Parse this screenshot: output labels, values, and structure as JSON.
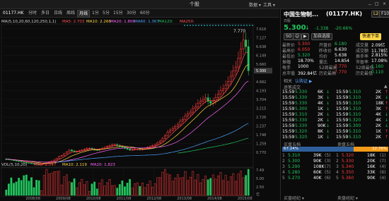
{
  "window": {
    "title": "个股",
    "menu": [
      "数据 ▾",
      "工具 ▾"
    ],
    "controls": [
      "－",
      "□",
      "×"
    ]
  },
  "tabs": {
    "items": [
      "01177.HK",
      "分时",
      "多日",
      "日线",
      "周线",
      "月线",
      "1分",
      "5分",
      "15分",
      "30分",
      "60分"
    ],
    "active": "月线"
  },
  "ma": {
    "label": "MA(5,10,20,60,120,250,1,1)",
    "items": [
      {
        "name": "MA5",
        "value": "2.703",
        "color": "#ff4d4d"
      },
      {
        "name": "MA10",
        "value": "2.266",
        "color": "#ffd84a"
      },
      {
        "name": "MA20",
        "value": "1.806",
        "color": "#ff66ff"
      },
      {
        "name": "MA60",
        "value": "1.367",
        "color": "#4aa3ff"
      },
      {
        "name": "MA120",
        "value": "",
        "color": "#22c55e"
      },
      {
        "name": "MA250",
        "value": "",
        "color": "#ff5555"
      }
    ],
    "gear_icon": "gear-icon"
  },
  "price_axis": [
    "7.616",
    "7.127",
    "6.638",
    "6.149",
    "5.660",
    "5.300",
    "4.682",
    "4.193",
    "3.704",
    "3.215",
    "2.726",
    "2.237",
    "1.748",
    "1.259",
    "0.770"
  ],
  "price_axis_highlight": "5.300",
  "peak_label": "7.770",
  "low_label": "0.110",
  "date_axis": [
    "2008/08",
    "2009/08",
    "2010/08",
    "2011/08",
    "2012/08",
    "2013/08",
    "2014/08",
    "2015/08"
  ],
  "vol": {
    "label": "VOL(5,10,20)",
    "items": [
      {
        "name": "MA5",
        "value": "2.047",
        "color": "#ff4d4d"
      },
      {
        "name": "MA10",
        "value": "2.119",
        "color": "#ffd84a"
      },
      {
        "name": "MA20",
        "value": "1.823",
        "color": "#ff66ff"
      }
    ],
    "axis": [
      "7.49",
      "5.00",
      "2.50",
      "亿"
    ],
    "unit": "亿"
  },
  "stock": {
    "name": "中国生物制...",
    "code": "(01177.HK)",
    "tag": "日股",
    "price": "5.300",
    "arrow": "↓",
    "change": "-1.338",
    "change_pct": "-20.66%",
    "buttons": [
      "SO",
      "☺",
      "▶",
      "加自选股"
    ],
    "badges": [
      "L2",
      "F10"
    ],
    "trade_button": "快速下单",
    "scroll_up": "▲"
  },
  "quote": [
    {
      "l": "最新价",
      "lv": "5.300",
      "lc": "red",
      "m": "开盘价",
      "mv": "6.180",
      "mc": "green",
      "r": "成交量",
      "rv": "2.09亿",
      "rc": "white"
    },
    {
      "l": "最高价",
      "lv": "6.050",
      "lc": "red",
      "m": "昨收价",
      "mv": "6.630",
      "mc": "white",
      "r": "成交额",
      "rv": "11.78亿",
      "rc": "white"
    },
    {
      "l": "最低价",
      "lv": "5.320",
      "lc": "green",
      "m": "均价",
      "mv": "5.638",
      "mc": "white",
      "r": "换手率",
      "rv": "2.815%",
      "rc": "white"
    },
    {
      "l": "振幅",
      "lv": "18.70%",
      "lc": "white",
      "m": "量比",
      "mv": "14.854",
      "mc": "white",
      "r": "市盈率",
      "rv": "17.08%",
      "rc": "white"
    },
    {
      "l": "每手",
      "lv": "1000",
      "lc": "white",
      "m": "52周最高",
      "mv": "7.770",
      "mc": "red",
      "r": "52周最低",
      "rv": "1.160",
      "rc": "green"
    },
    {
      "l": "总市值",
      "lv": "392.84亿",
      "lc": "white",
      "m": "历史最高",
      "mv": "7.770",
      "mc": "red",
      "r": "历史最低",
      "rv": "0.110",
      "rc": "green"
    }
  ],
  "link": {
    "label": "相关",
    "value": "认购证 ▶"
  },
  "trades_header": "逐笔成交",
  "trades": [
    {
      "t": "15:59",
      "p": "5.330",
      "v": "6K",
      "d": "↓",
      "t2": "15:59",
      "p2": "5.310",
      "v2": "2K",
      "d2": "↑"
    },
    {
      "t": "15:59",
      "p": "5.330",
      "v": "3K",
      "d": "↓",
      "t2": "15:59",
      "p2": "5.310",
      "v2": "2K",
      "d2": "↓"
    },
    {
      "t": "15:59",
      "p": "5.330",
      "v": "4K",
      "d": "↓",
      "t2": "15:59",
      "p2": "5.310",
      "v2": "18K",
      "d2": "↑"
    },
    {
      "t": "15:59",
      "p": "5.300",
      "v": "1K",
      "d": "↓",
      "t2": "15:59",
      "p2": "5.310",
      "v2": "3K",
      "d2": "↑"
    },
    {
      "t": "15:59",
      "p": "5.310",
      "v": "2K",
      "d": "↓",
      "t2": "15:59",
      "p2": "5.310",
      "v2": "4K",
      "d2": "↓"
    },
    {
      "t": "15:59",
      "p": "5.330",
      "v": "2K",
      "d": "↓",
      "t2": "15:59",
      "p2": "5.320",
      "v2": "4K",
      "d2": "↓"
    },
    {
      "t": "15:59",
      "p": "5.330",
      "v": "90K",
      "d": "↓",
      "t2": "15:59",
      "p2": "5.300",
      "v2": "2K",
      "d2": "↓"
    },
    {
      "t": "15:59",
      "p": "5.320",
      "v": "8K",
      "d": "↓",
      "t2": "15:59",
      "p2": "5.310",
      "v2": "1K",
      "d2": "↑"
    },
    {
      "t": "15:59",
      "p": "5.320",
      "v": "1K",
      "d": "↓",
      "t2": "15:59",
      "p2": "5.310",
      "v2": "2K",
      "d2": "↑"
    }
  ],
  "depth": {
    "buy_title": "买盘五档",
    "sell_title": "卖盘五档",
    "buy_pct": "67.24%",
    "sell_pct": "32.76%",
    "buy_ratio": 0.6724,
    "buy": [
      {
        "i": "1",
        "p": "5.310",
        "v": "39K",
        "n": "5"
      },
      {
        "i": "2",
        "p": "5.300",
        "v": "90K",
        "n": "3"
      },
      {
        "i": "3",
        "p": "5.290",
        "v": "108K",
        "n": "7"
      },
      {
        "i": "4",
        "p": "5.280",
        "v": "60K",
        "n": "5"
      },
      {
        "i": "5",
        "p": "5.270",
        "v": "40K",
        "n": "6"
      }
    ],
    "sell": [
      {
        "i": "1",
        "p": "5.320",
        "v": "18K",
        "n": "1"
      },
      {
        "i": "2",
        "p": "5.330",
        "v": "20K",
        "n": "7"
      },
      {
        "i": "3",
        "p": "5.340",
        "v": "16K",
        "n": "4"
      },
      {
        "i": "4",
        "p": "5.350",
        "v": "33K",
        "n": "6"
      },
      {
        "i": "5",
        "p": "5.360",
        "v": "90K",
        "n": "4"
      }
    ],
    "footer_left": "买盘经纪 ▾",
    "footer_right": "卖盘经纪 ▾"
  },
  "colors": {
    "up": "#ff3b3b",
    "down": "#22c55e",
    "ma5": "#ff4d4d",
    "ma10": "#ffd84a",
    "ma20": "#ff66ff",
    "ma60": "#4aa3ff",
    "ma120": "#22c55e"
  },
  "chart_data": {
    "type": "candlestick",
    "period": "monthly",
    "ylim": [
      0.11,
      7.77
    ],
    "x_range": [
      "2007/09",
      "2015/08"
    ],
    "series_close": [
      0.4,
      0.38,
      0.35,
      0.32,
      0.3,
      0.28,
      0.25,
      0.22,
      0.2,
      0.18,
      0.16,
      0.15,
      0.13,
      0.12,
      0.12,
      0.15,
      0.2,
      0.25,
      0.3,
      0.35,
      0.45,
      0.55,
      0.6,
      0.7,
      0.8,
      0.9,
      0.85,
      0.8,
      0.82,
      0.86,
      0.9,
      0.95,
      1.0,
      1.0,
      0.95,
      0.92,
      0.9,
      0.95,
      1.0,
      1.05,
      1.1,
      1.15,
      1.2,
      1.2,
      1.15,
      1.1,
      1.05,
      1.0,
      0.95,
      0.9,
      0.92,
      0.95,
      0.95,
      0.92,
      0.95,
      1.0,
      1.05,
      1.1,
      1.15,
      1.2,
      1.3,
      1.4,
      1.55,
      1.7,
      1.9,
      2.0,
      2.1,
      2.2,
      2.3,
      2.5,
      2.6,
      2.8,
      2.9,
      3.0,
      3.2,
      3.3,
      3.5,
      3.6,
      3.7,
      3.8,
      3.6,
      3.5,
      3.6,
      3.8,
      4.0,
      4.2,
      4.3,
      4.5,
      4.7,
      5.0,
      5.3,
      5.5,
      6.0,
      6.5,
      7.0,
      6.63,
      5.3
    ],
    "volume_scale": [
      0,
      7.49
    ]
  }
}
